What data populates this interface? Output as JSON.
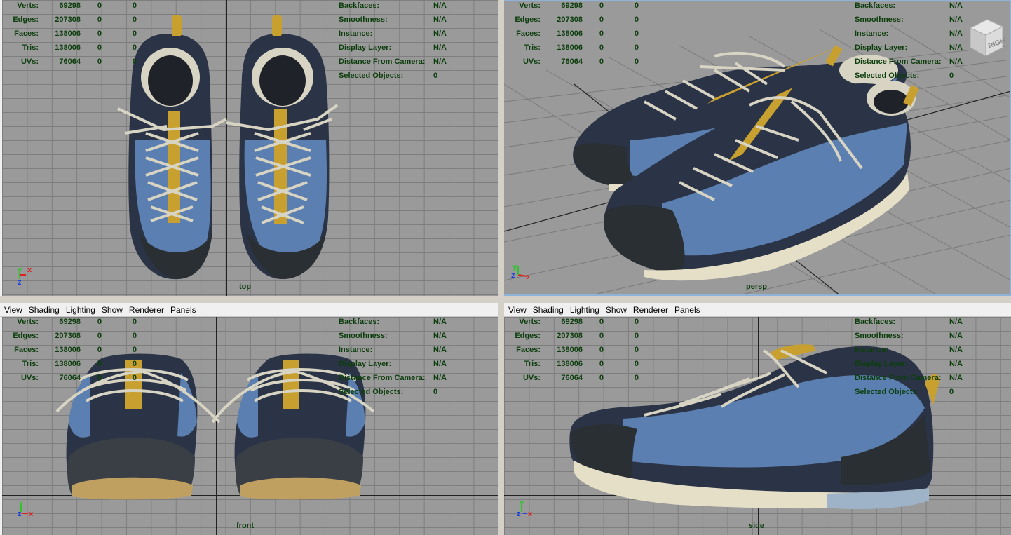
{
  "menu": [
    "View",
    "Shading",
    "Lighting",
    "Show",
    "Renderer",
    "Panels"
  ],
  "hud_left": [
    {
      "label": "Verts:",
      "v1": "69298",
      "v2": "0",
      "v3": "0"
    },
    {
      "label": "Edges:",
      "v1": "207308",
      "v2": "0",
      "v3": "0"
    },
    {
      "label": "Faces:",
      "v1": "138006",
      "v2": "0",
      "v3": "0"
    },
    {
      "label": "Tris:",
      "v1": "138006",
      "v2": "0",
      "v3": "0"
    },
    {
      "label": "UVs:",
      "v1": "76064",
      "v2": "0",
      "v3": "0"
    }
  ],
  "hud_right": [
    {
      "label": "Backfaces:",
      "value": "N/A"
    },
    {
      "label": "Smoothness:",
      "value": "N/A"
    },
    {
      "label": "Instance:",
      "value": "N/A"
    },
    {
      "label": "Display Layer:",
      "value": "N/A"
    },
    {
      "label": "Distance From Camera:",
      "value": "N/A"
    },
    {
      "label": "Selected Objects:",
      "value": "0"
    }
  ],
  "viewports": {
    "top": {
      "label": "top"
    },
    "persp": {
      "label": "persp",
      "viewcube": "RIGHT"
    },
    "front": {
      "label": "front"
    },
    "side": {
      "label": "side"
    }
  },
  "axes": {
    "x": "x",
    "y": "y",
    "z": "z"
  },
  "colors": {
    "grid_bg": "#9a9a9a",
    "hud_text": "#0c3d0c",
    "shoe_blue": "#5b7fb0",
    "shoe_dark": "#2b3446",
    "lace": "#d8d4c4",
    "strap_yellow": "#c8a030"
  }
}
